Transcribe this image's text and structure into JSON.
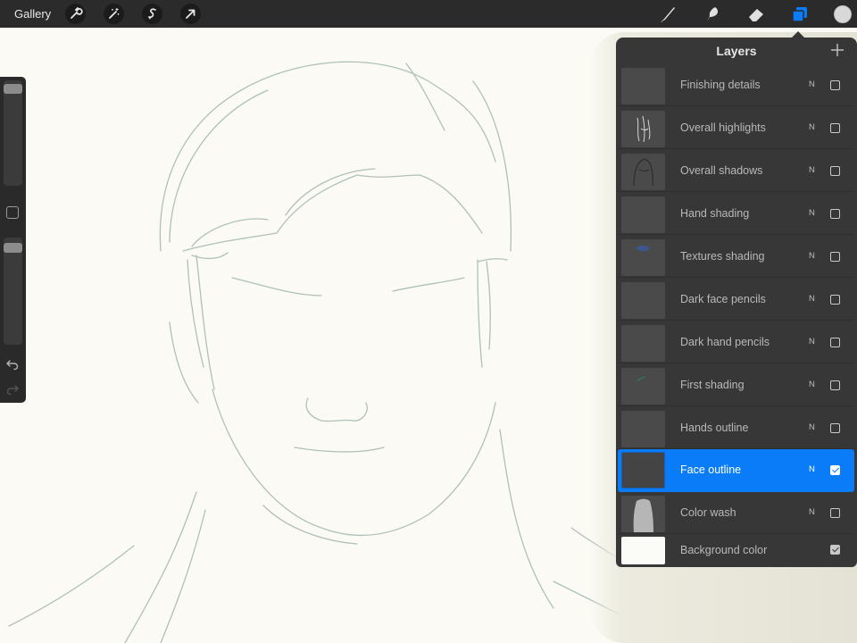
{
  "topbar": {
    "gallery_label": "Gallery",
    "left_tools": [
      "wrench-icon",
      "magic-wand-icon",
      "selection-icon",
      "transform-arrow-icon"
    ],
    "right_tools": [
      "brush-icon",
      "smudge-icon",
      "eraser-icon",
      "layers-icon"
    ],
    "active_tool": "layers-icon",
    "current_color": "#d8d8d8"
  },
  "sidebar": {
    "brush_size_level": 0.98,
    "opacity_level": 0.96,
    "icons": [
      "modify-square-icon",
      "undo-icon",
      "redo-icon"
    ]
  },
  "layers_panel": {
    "title": "Layers",
    "add_icon": "plus-icon",
    "layers": [
      {
        "name": "Finishing details",
        "blend": "N",
        "visible": false,
        "active": false
      },
      {
        "name": "Overall highlights",
        "blend": "N",
        "visible": false,
        "active": false
      },
      {
        "name": "Overall shadows",
        "blend": "N",
        "visible": false,
        "active": false
      },
      {
        "name": "Hand shading",
        "blend": "N",
        "visible": false,
        "active": false
      },
      {
        "name": "Textures shading",
        "blend": "N",
        "visible": false,
        "active": false
      },
      {
        "name": "Dark face pencils",
        "blend": "N",
        "visible": false,
        "active": false
      },
      {
        "name": "Dark hand pencils",
        "blend": "N",
        "visible": false,
        "active": false
      },
      {
        "name": "First shading",
        "blend": "N",
        "visible": false,
        "active": false
      },
      {
        "name": "Hands outline",
        "blend": "N",
        "visible": false,
        "active": false
      },
      {
        "name": "Face outline",
        "blend": "N",
        "visible": true,
        "active": true
      },
      {
        "name": "Color wash",
        "blend": "N",
        "visible": false,
        "active": false
      },
      {
        "name": "Background color",
        "blend": "",
        "visible": true,
        "active": false
      }
    ]
  },
  "colors": {
    "accent": "#0a7cf8",
    "canvas": "#fbfaf4",
    "toolbar": "#2b2b2b",
    "panel": "#373737",
    "sketch_stroke": "#9fb3ad"
  }
}
